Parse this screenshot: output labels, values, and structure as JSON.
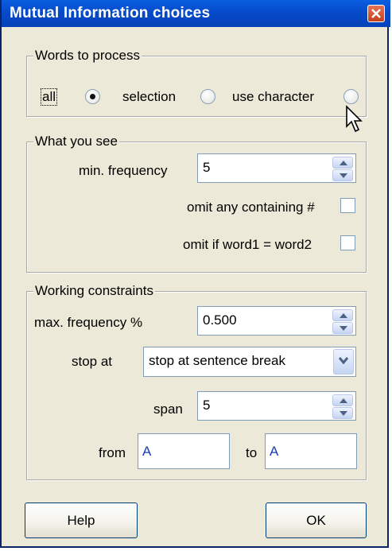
{
  "window": {
    "title": "Mutual Information choices"
  },
  "words_to_process": {
    "legend": "Words to process",
    "options": [
      {
        "label": "all",
        "selected": true
      },
      {
        "label": "selection",
        "selected": false
      },
      {
        "label": "use character",
        "selected": false
      }
    ]
  },
  "what_you_see": {
    "legend": "What you see",
    "min_frequency_label": "min. frequency",
    "min_frequency_value": "5",
    "omit_containing_label": "omit any containing #",
    "omit_containing_checked": false,
    "omit_same_label": "omit if word1 = word2",
    "omit_same_checked": false
  },
  "working_constraints": {
    "legend": "Working constraints",
    "max_frequency_label": "max. frequency %",
    "max_frequency_value": "0.500",
    "stop_at_label": "stop at",
    "stop_at_value": "stop at sentence break",
    "span_label": "span",
    "span_value": "5",
    "from_label": "from",
    "from_value": "A",
    "to_label": "to",
    "to_value": "A"
  },
  "buttons": {
    "help": "Help",
    "ok": "OK"
  },
  "colors": {
    "titlebar": "#0549c8",
    "dialog_bg": "#ece9d8",
    "close": "#c4401d"
  }
}
